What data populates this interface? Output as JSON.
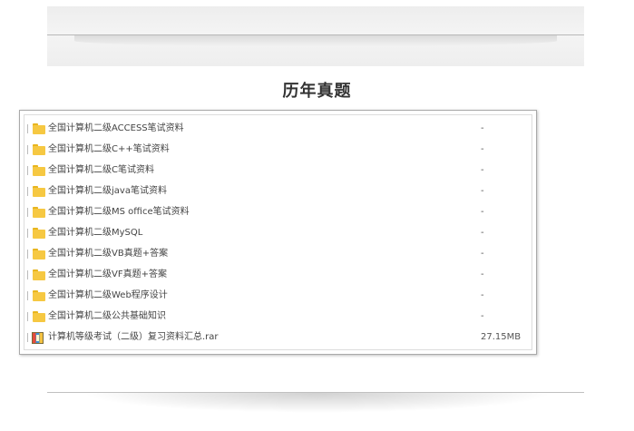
{
  "page": {
    "title": "历年真题"
  },
  "files": [
    {
      "name": "全国计算机二级ACCESS笔试资料",
      "size": "-",
      "type": "folder"
    },
    {
      "name": "全国计算机二级C++笔试资料",
      "size": "-",
      "type": "folder"
    },
    {
      "name": "全国计算机二级C笔试资料",
      "size": "-",
      "type": "folder"
    },
    {
      "name": "全国计算机二级java笔试资料",
      "size": "-",
      "type": "folder"
    },
    {
      "name": "全国计算机二级MS office笔试资料",
      "size": "-",
      "type": "folder"
    },
    {
      "name": "全国计算机二级MySQL",
      "size": "-",
      "type": "folder"
    },
    {
      "name": "全国计算机二级VB真题+答案",
      "size": "-",
      "type": "folder"
    },
    {
      "name": "全国计算机二级VF真题+答案",
      "size": "-",
      "type": "folder"
    },
    {
      "name": "全国计算机二级Web程序设计",
      "size": "-",
      "type": "folder"
    },
    {
      "name": "全国计算机二级公共基础知识",
      "size": "-",
      "type": "folder"
    },
    {
      "name": "计算机等级考试（二级）复习资料汇总.rar",
      "size": "27.15MB",
      "type": "archive"
    }
  ],
  "icons": {
    "folder": "folder-icon",
    "archive": "archive-icon"
  },
  "colors": {
    "folder": "#f6c842",
    "panel_border": "#a9a9a9"
  }
}
